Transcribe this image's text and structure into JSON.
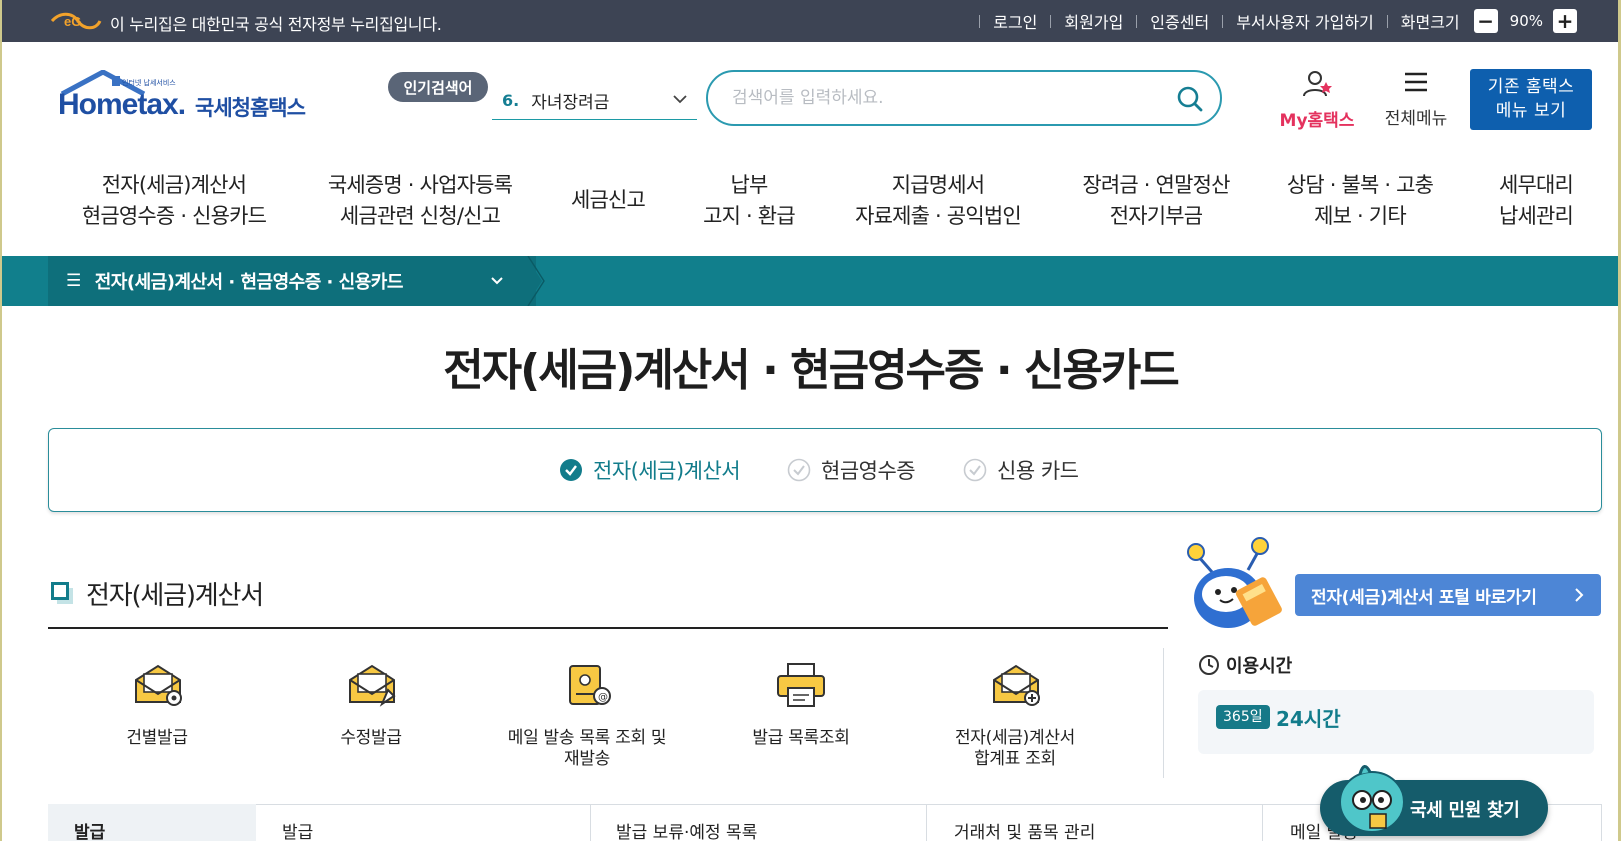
{
  "gov_bar": {
    "notice": "이 누리집은 대한민국 공식 전자정부 누리집입니다.",
    "links": [
      "로그인",
      "회원가입",
      "인증센터",
      "부서사용자 가입하기",
      "화면크기"
    ],
    "zoom_minus": "−",
    "zoom_value": "90%",
    "zoom_plus": "+"
  },
  "logo": {
    "en": "Hometax.",
    "ko": "국세청홈택스",
    "tagline": "인터넷 납세서비스"
  },
  "popular": {
    "badge": "인기검색어",
    "rank": "6.",
    "keyword": "자녀장려금"
  },
  "search": {
    "placeholder": "검색어를 입력하세요."
  },
  "header_actions": {
    "my_hometax": "My홈택스",
    "all_menu": "전체메뉴",
    "legacy_line1": "기존 홈택스",
    "legacy_line2": "메뉴 보기"
  },
  "gnb": [
    {
      "line1": "전자(세금)계산서",
      "line2": "현금영수증 · 신용카드"
    },
    {
      "line1": "국세증명 · 사업자등록",
      "line2": "세금관련 신청/신고"
    },
    {
      "line1": "세금신고",
      "line2": ""
    },
    {
      "line1": "납부",
      "line2": "고지 · 환급"
    },
    {
      "line1": "지급명세서",
      "line2": "자료제출 · 공익법인"
    },
    {
      "line1": "장려금 · 연말정산",
      "line2": "전자기부금"
    },
    {
      "line1": "상담 · 불복 · 고충",
      "line2": "제보 · 기타"
    },
    {
      "line1": "세무대리",
      "line2": "납세관리"
    }
  ],
  "breadcrumb": {
    "current": "전자(세금)계산서 · 현금영수증 · 신용카드"
  },
  "page_title": "전자(세금)계산서 · 현금영수증 · 신용카드",
  "tabs": [
    {
      "label": "전자(세금)계산서",
      "active": true
    },
    {
      "label": "현금영수증",
      "active": false
    },
    {
      "label": "신용 카드",
      "active": false
    }
  ],
  "section": {
    "title": "전자(세금)계산서",
    "portal_button": "전자(세금)계산서 포털 바로가기"
  },
  "quick_menu": [
    {
      "line1": "건별발급",
      "line2": "",
      "icon": "envelope-gear-icon"
    },
    {
      "line1": "수정발급",
      "line2": "",
      "icon": "envelope-edit-icon"
    },
    {
      "line1": "메일 발송 목록 조회 및",
      "line2": "재발송",
      "icon": "mail-scroll-icon"
    },
    {
      "line1": "발급 목록조회",
      "line2": "",
      "icon": "printer-icon"
    },
    {
      "line1": "전자(세금)계산서",
      "line2": "합계표 조회",
      "icon": "envelope-plus-icon"
    }
  ],
  "usage": {
    "title": "이용시간",
    "badge": "365일",
    "value": "24시간"
  },
  "bottom_tabs": [
    "발급",
    "발급",
    "발급 보류·예정 목록",
    "거래처 및 품목 관리",
    "메일 발송"
  ],
  "floating": {
    "civil_button": "국세 민원 찾기"
  },
  "colors": {
    "gov_bar": "#3d4454",
    "teal": "#117f8c",
    "brand_blue": "#0e5fae",
    "accent_pink": "#e4325e"
  }
}
